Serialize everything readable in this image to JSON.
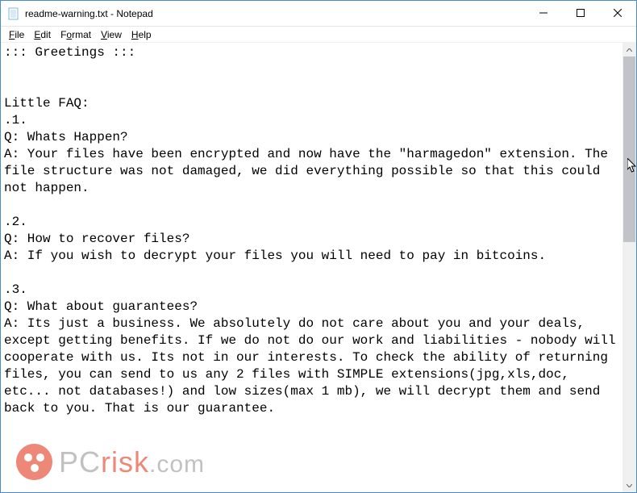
{
  "titlebar": {
    "icon": "notepad-icon",
    "title": "readme-warning.txt - Notepad"
  },
  "menubar": {
    "items": [
      {
        "label": "File",
        "underline": "F"
      },
      {
        "label": "Edit",
        "underline": "E"
      },
      {
        "label": "Format",
        "underline": "o"
      },
      {
        "label": "View",
        "underline": "V"
      },
      {
        "label": "Help",
        "underline": "H"
      }
    ]
  },
  "content": {
    "text": "::: Greetings :::\n\n\nLittle FAQ:\n.1.\nQ: Whats Happen?\nA: Your files have been encrypted and now have the \"harmagedon\" extension. The file structure was not damaged, we did everything possible so that this could not happen.\n\n.2.\nQ: How to recover files?\nA: If you wish to decrypt your files you will need to pay in bitcoins.\n\n.3.\nQ: What about guarantees?\nA: Its just a business. We absolutely do not care about you and your deals, except getting benefits. If we do not do our work and liabilities - nobody will cooperate with us. Its not in our interests. To check the ability of returning files, you can send to us any 2 files with SIMPLE extensions(jpg,xls,doc, etc... not databases!) and low sizes(max 1 mb), we will decrypt them and send back to you. That is our guarantee."
  },
  "watermark": {
    "pc": "PC",
    "risk": "risk",
    "dotcom": ".com"
  }
}
